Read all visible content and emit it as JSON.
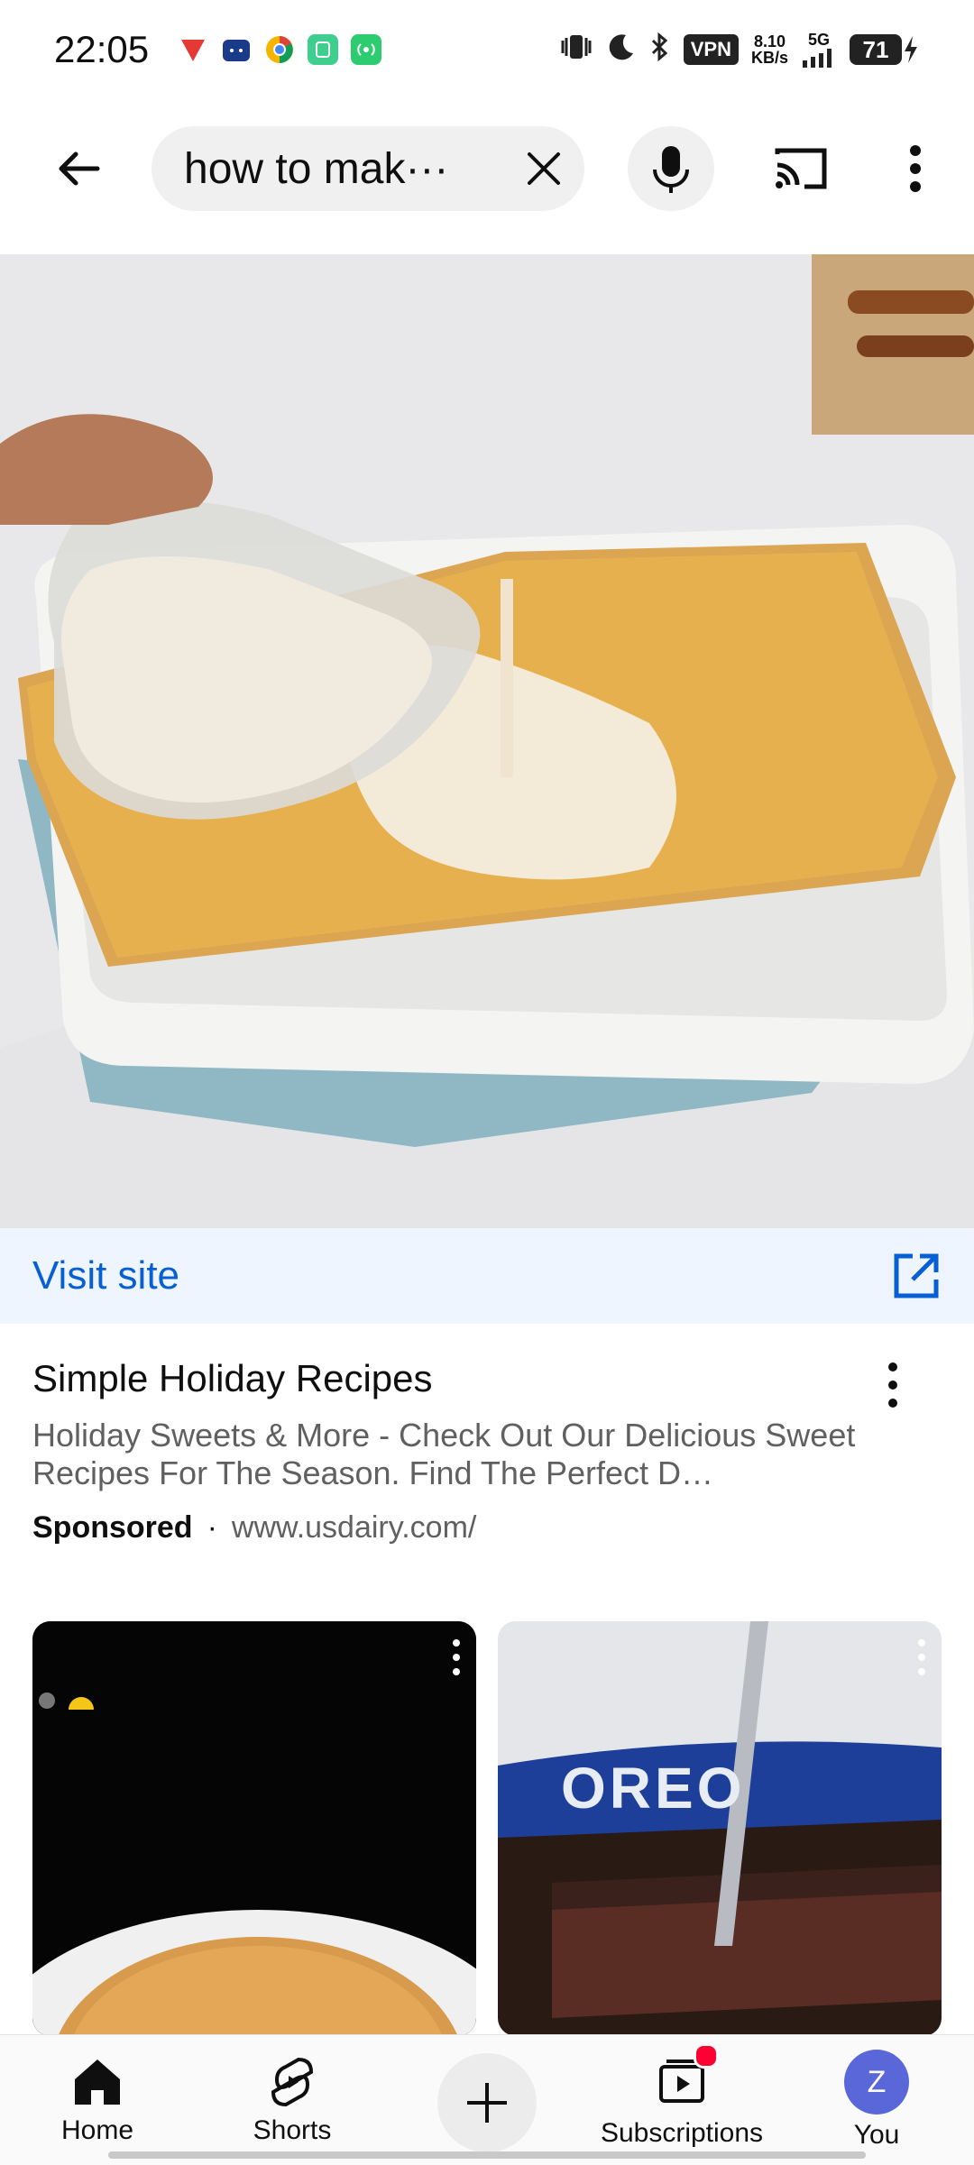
{
  "status_bar": {
    "time": "22:05",
    "vpn": "VPN",
    "net_speed_value": "8.10",
    "net_speed_unit": "KB/s",
    "network": "5G",
    "battery": "71"
  },
  "search": {
    "query": "how to mak···"
  },
  "ad": {
    "visit_label": "Visit site",
    "title": "Simple Holiday Recipes",
    "description": "Holiday Sweets & More - Check Out Our Delicious Sweet Recipes For The Season. Find The Perfect D…",
    "sponsored_label": "Sponsored",
    "separator": "·",
    "url": "www.usdairy.com/"
  },
  "shorts": [
    {
      "id": "short-1"
    },
    {
      "id": "short-2",
      "brand_text": "OREO"
    }
  ],
  "bottom_nav": {
    "items": [
      {
        "label": "Home"
      },
      {
        "label": "Shorts"
      },
      {
        "label": "Subscriptions"
      },
      {
        "label": "You"
      }
    ],
    "avatar_letter": "Z"
  },
  "colors": {
    "link": "#065fd4",
    "visit_bg": "#eef5ff",
    "notification": "#ff0033",
    "avatar": "#5a67d8"
  }
}
